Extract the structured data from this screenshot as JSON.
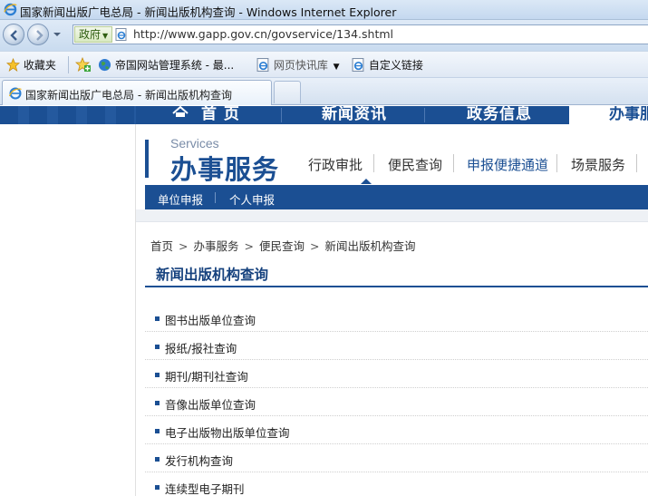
{
  "window": {
    "title": "国家新闻出版广电总局 - 新闻出版机构查询 - Windows Internet Explorer"
  },
  "address_bar": {
    "zone_label": "政府",
    "url": "http://www.gapp.gov.cn/govservice/134.shtml"
  },
  "favorites_bar": {
    "favorites_label": "收藏夹",
    "items": [
      {
        "label": "帝国网站管理系统 - 最...",
        "icon": "globe-icon"
      },
      {
        "label": "网页快讯库",
        "icon": "ie-page-icon"
      },
      {
        "label": "自定义链接",
        "icon": "ie-page-icon"
      }
    ]
  },
  "tabs": [
    {
      "label": "国家新闻出版广电总局 - 新闻出版机构查询",
      "active": true
    }
  ],
  "site": {
    "top_nav": [
      "首 页",
      "新闻资讯",
      "政务信息",
      "办事服"
    ],
    "section_en": "Services",
    "section_cn": "办事服务",
    "section_tabs": [
      "行政审批",
      "便民查询",
      "申报便捷通道",
      "场景服务"
    ],
    "active_section_tab": "申报便捷通道",
    "sub_nav": [
      "单位申报",
      "个人申报"
    ],
    "breadcrumb": [
      "首页",
      "办事服务",
      "便民查询",
      "新闻出版机构查询"
    ],
    "page_title": "新闻出版机构查询",
    "services": [
      "图书出版单位查询",
      "报纸/报社查询",
      "期刊/期刊社查询",
      "音像出版单位查询",
      "电子出版物出版单位查询",
      "发行机构查询",
      "连续型电子期刊"
    ]
  },
  "colors": {
    "brand_blue": "#1b4f93",
    "title_blue": "#16427e"
  }
}
